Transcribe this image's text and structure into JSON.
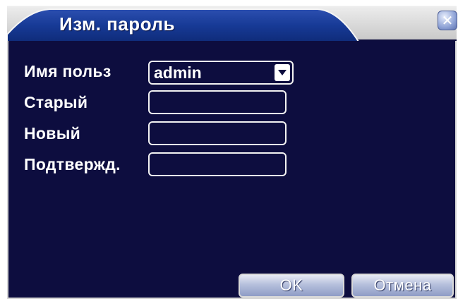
{
  "dialog": {
    "title": "Изм. пароль",
    "close_icon": "close-icon"
  },
  "form": {
    "username_label": "Имя польз",
    "username_value": "admin",
    "old_password_label": "Старый",
    "old_password_value": "",
    "new_password_label": "Новый",
    "new_password_value": "",
    "confirm_password_label": "Подтвержд.",
    "confirm_password_value": ""
  },
  "buttons": {
    "ok_label": "OK",
    "cancel_label": "Отмена"
  },
  "colors": {
    "body_background": "#0d0d3f",
    "title_bar": "#d9d9d9",
    "title_tab": "#1e3a8a",
    "text": "#ffffff"
  }
}
